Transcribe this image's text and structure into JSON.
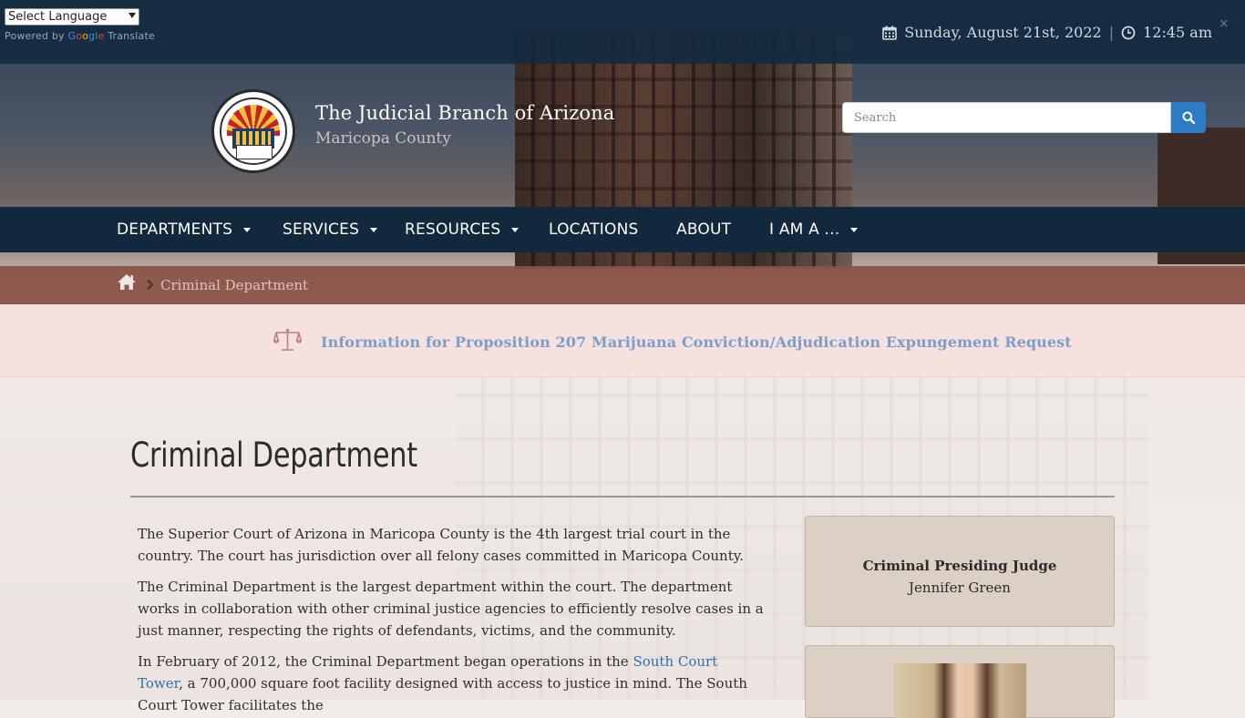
{
  "topbar": {
    "language_select": "Select Language",
    "powered_by": "Powered by",
    "google": [
      "G",
      "o",
      "o",
      "g",
      "l",
      "e"
    ],
    "translate": "Translate",
    "close": "×",
    "date": "Sunday, August 21st, 2022",
    "divider": "|",
    "time": "12:45 am"
  },
  "header": {
    "title": "The Judicial Branch of Arizona",
    "subtitle": "Maricopa County",
    "search_placeholder": "Search"
  },
  "nav": {
    "items": [
      {
        "label": "DEPARTMENTS",
        "dropdown": true
      },
      {
        "label": "SERVICES",
        "dropdown": true
      },
      {
        "label": "RESOURCES",
        "dropdown": true
      },
      {
        "label": "LOCATIONS",
        "dropdown": false
      },
      {
        "label": "ABOUT",
        "dropdown": false
      },
      {
        "label": "I AM A ...",
        "dropdown": true
      }
    ]
  },
  "breadcrumb": {
    "current": "Criminal Department"
  },
  "alert": {
    "link_text": "Information for Proposition 207 Marijuana Conviction/Adjudication Expungement Request"
  },
  "main": {
    "title": "Criminal Department",
    "p1": "The Superior Court of Arizona in Maricopa County is the 4th largest trial court in the country.  The court has jurisdiction over all felony cases committed in Maricopa County.",
    "p2": "The Criminal Department is the largest department within the court.  The department works in collaboration with other criminal justice agencies to efficiently resolve cases in a just manner, respecting the rights of defendants, victims, and the community.",
    "p3_before": "In February of 2012, the Criminal Department began operations in the ",
    "p3_link": "South Court Tower",
    "p3_after": ", a 700,000 square foot facility designed with access to justice in mind.  The South Court Tower facilitates the"
  },
  "sidebar": {
    "judge_title": "Criminal Presiding Judge",
    "judge_name": "Jennifer Green"
  },
  "colors": {
    "topbar": "#142a40",
    "nav": "#12283d",
    "breadcrumb": "#8a5246",
    "alert_bg": "#f6e2e0",
    "alert_link": "#7d9ec7",
    "search_button": "#2d7bc4",
    "card": "#dccfc3"
  }
}
